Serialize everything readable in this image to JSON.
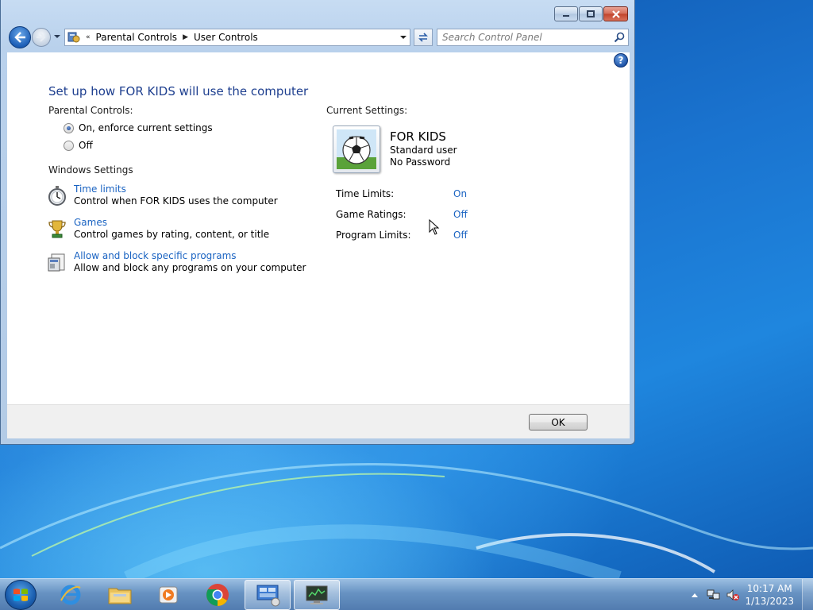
{
  "window": {
    "breadcrumb": [
      "Parental Controls",
      "User Controls"
    ],
    "breadcrumb_overflow": "«",
    "search_placeholder": "Search Control Panel"
  },
  "page": {
    "title": "Set up how FOR KIDS will use the computer",
    "parental_controls_label": "Parental Controls:",
    "radio_on": "On, enforce current settings",
    "radio_off": "Off",
    "windows_settings_label": "Windows Settings",
    "settings": [
      {
        "link": "Time limits",
        "desc": "Control when FOR KIDS uses the computer",
        "icon": "stopwatch-icon"
      },
      {
        "link": "Games",
        "desc": "Control games by rating, content, or title",
        "icon": "trophy-icon"
      },
      {
        "link": "Allow and block specific programs",
        "desc": "Allow and block any programs on your computer",
        "icon": "programs-icon"
      }
    ],
    "current_settings_label": "Current Settings:",
    "user": {
      "name": "FOR KIDS",
      "type": "Standard user",
      "password": "No Password"
    },
    "stats": [
      {
        "label": "Time Limits:",
        "value": "On"
      },
      {
        "label": "Game Ratings:",
        "value": "Off"
      },
      {
        "label": "Program Limits:",
        "value": "Off"
      }
    ],
    "ok_label": "OK"
  },
  "taskbar": {
    "apps": [
      "internet-explorer-icon",
      "file-explorer-icon",
      "media-player-icon",
      "chrome-icon",
      "control-panel-icon",
      "system-monitor-icon"
    ],
    "time": "10:17 AM",
    "date": "1/13/2023"
  },
  "colors": {
    "link": "#1a63c2",
    "title": "#1e3f8f"
  }
}
